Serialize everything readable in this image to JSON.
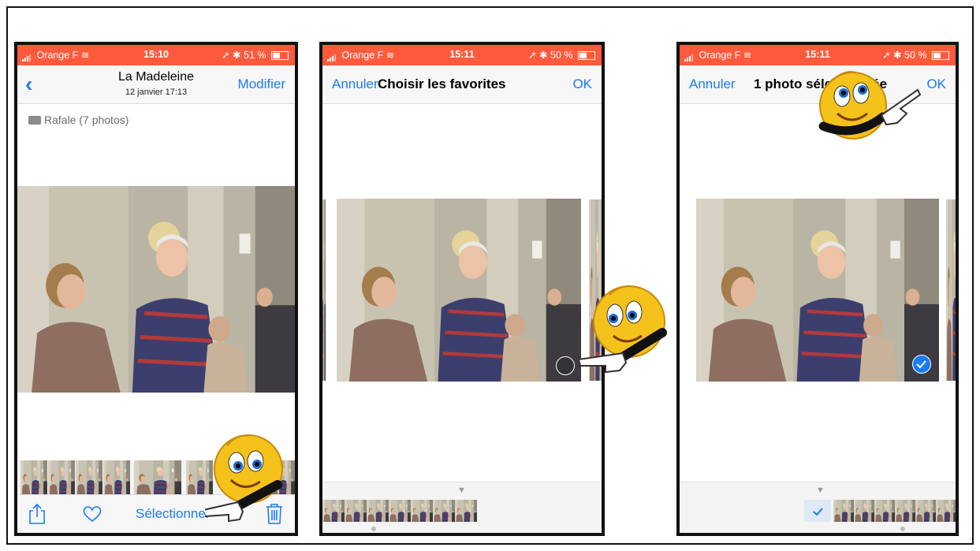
{
  "colors": {
    "status_bar": "#ff5a3c",
    "ios_blue": "#1a7cf5",
    "nav_bg": "#f7f7f7"
  },
  "screen1": {
    "status": {
      "carrier": "Orange F",
      "time": "15:10",
      "battery": "51 %",
      "battery_level": 0.51
    },
    "nav": {
      "back_icon": "chevron-left-icon",
      "title": "La Madeleine",
      "subtitle": "12 janvier  17:13",
      "right": "Modifier"
    },
    "burst_label": "Rafale (7 photos)",
    "toolbar": {
      "share_icon": "share-icon",
      "heart_icon": "heart-icon",
      "select_label": "Sélectionner",
      "trash_icon": "trash-icon"
    }
  },
  "screen2": {
    "status": {
      "carrier": "Orange F",
      "time": "15:11",
      "battery": "50 %",
      "battery_level": 0.5
    },
    "nav": {
      "left": "Annuler",
      "title": "Choisir les favorites",
      "right": "OK"
    }
  },
  "screen3": {
    "status": {
      "carrier": "Orange F",
      "time": "15:11",
      "battery": "50 %",
      "battery_level": 0.5
    },
    "nav": {
      "left": "Annuler",
      "title": "1 photo sélectionnée",
      "right": "OK"
    }
  }
}
